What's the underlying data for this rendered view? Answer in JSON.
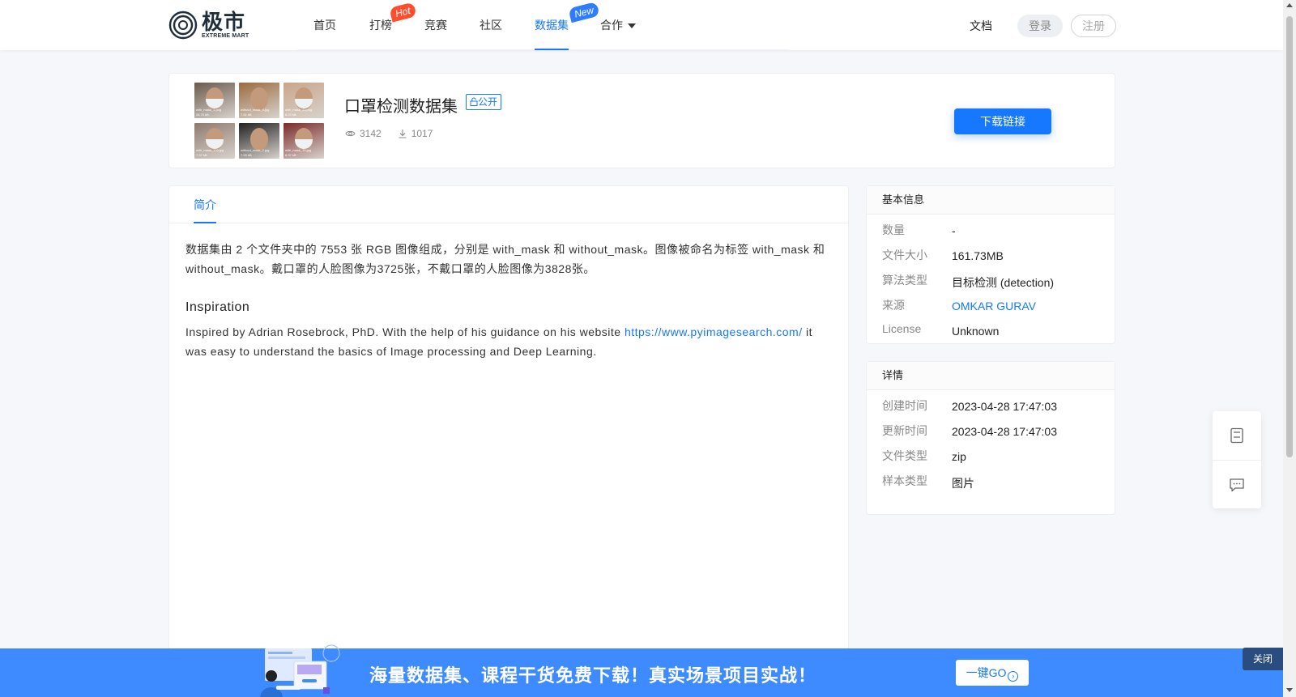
{
  "brand": {
    "name_cn": "极市",
    "name_en": "EXTREME MART"
  },
  "nav": {
    "items": [
      {
        "label": "首页"
      },
      {
        "label": "打榜",
        "badge": "Hot"
      },
      {
        "label": "竞赛"
      },
      {
        "label": "社区"
      },
      {
        "label": "数据集",
        "badge": "New",
        "active": true
      },
      {
        "label": "合作"
      }
    ]
  },
  "header_right": {
    "docs": "文档",
    "login": "登录",
    "register": "注册"
  },
  "dataset": {
    "title": "口罩检测数据集",
    "visibility_tag": "公开",
    "views": "3142",
    "downloads": "1017",
    "download_button": "下载链接",
    "thumbnails": [
      {
        "caption": "with_mask_1.png",
        "size": "28.70 kB",
        "tone": "#6a5a4c",
        "mask": true
      },
      {
        "caption": "without_mask_4.jpg",
        "size": "7.61 kB",
        "tone": "#9a6b3f",
        "mask": false
      },
      {
        "caption": "with_mask_11.png",
        "size": "6.23 kB",
        "tone": "#c9a58a",
        "mask": true
      },
      {
        "caption": "with_mask_100.jpg",
        "size": "7.37 kB",
        "tone": "#8e7a6e",
        "mask": true
      },
      {
        "caption": "without_mask_2.jpg",
        "size": "7.93 kB",
        "tone": "#222222",
        "mask": false
      },
      {
        "caption": "with_mask_15.jpg",
        "size": "6.37 kB",
        "tone": "#7a2a2a",
        "mask": true
      }
    ]
  },
  "tabs": {
    "intro": "简介"
  },
  "intro": {
    "paragraph1": "数据集由 2 个文件夹中的 7553 张 RGB 图像组成，分别是 with_mask 和 without_mask。图像被命名为标签 with_mask 和 without_mask。戴口罩的人脸图像为3725张，不戴口罩的人脸图像为3828张。",
    "heading": "Inspiration",
    "paragraph2_before": "Inspired by Adrian Rosebrock, PhD. With the help of his guidance on his website ",
    "link": "https://www.pyimagesearch.com/",
    "paragraph2_after": " it was easy to understand the basics of Image processing and Deep Learning."
  },
  "basic_info": {
    "title": "基本信息",
    "rows": [
      {
        "key": "数量",
        "value": "-"
      },
      {
        "key": "文件大小",
        "value": "161.73MB"
      },
      {
        "key": "算法类型",
        "value": "目标检测 (detection)"
      },
      {
        "key": "来源",
        "value": "OMKAR GURAV",
        "link": true
      },
      {
        "key": "License",
        "value": "Unknown"
      }
    ]
  },
  "details": {
    "title": "详情",
    "rows": [
      {
        "key": "创建时间",
        "value": "2023-04-28 17:47:03"
      },
      {
        "key": "更新时间",
        "value": "2023-04-28 17:47:03"
      },
      {
        "key": "文件类型",
        "value": "zip"
      },
      {
        "key": "样本类型",
        "value": "图片"
      }
    ]
  },
  "float_tools": {
    "items": [
      "document-icon",
      "feedback-icon"
    ]
  },
  "banner": {
    "text": "海量数据集、课程干货免费下载！真实场景项目实战！",
    "go_button": "一键GO",
    "close_button": "关闭"
  },
  "colors": {
    "accent": "#1677ff",
    "hot": "#ff4d2e",
    "banner": "#3d8bff",
    "close_bg": "#2a4d7f"
  }
}
